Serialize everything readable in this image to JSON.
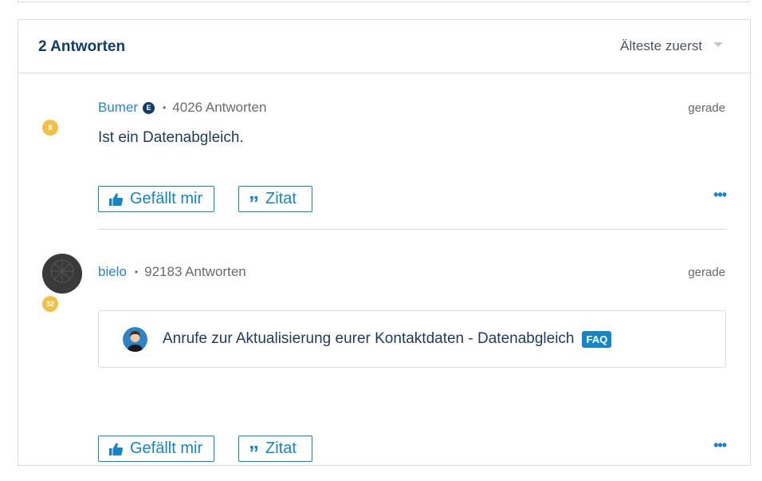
{
  "thread": {
    "reply_count": "2 Antworten",
    "sort": {
      "selected": "Älteste zuerst"
    }
  },
  "posts": [
    {
      "author": "Bumer",
      "expert_badge": "E",
      "rank": "8",
      "reply_stat": "4026 Antworten",
      "timestamp": "gerade",
      "body": "Ist ein Datenabgleich.",
      "like_label": "Gefällt mir",
      "quote_label": "Zitat"
    },
    {
      "author": "bielo",
      "rank": "32",
      "reply_stat": "92183 Antworten",
      "timestamp": "gerade",
      "linked_article": {
        "title": "Anrufe zur Aktualisierung eurer Kontaktdaten - Datenabgleich",
        "badge": "FAQ"
      },
      "like_label": "Gefällt mir",
      "quote_label": "Zitat"
    }
  ],
  "colors": {
    "accent": "#1585c5",
    "heading": "#143b66",
    "rank_badge": "#f0c04a",
    "border": "#dcdcdc"
  },
  "icons": {
    "like": "thumbs-up-icon",
    "quote": "quote-icon",
    "more": "more-dots-icon",
    "sort": "caret-down-icon"
  }
}
